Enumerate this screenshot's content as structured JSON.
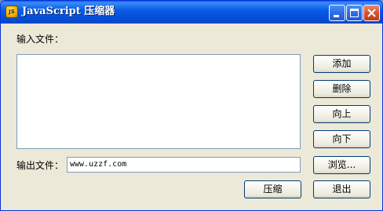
{
  "window": {
    "title": "JavaScript 压缩器",
    "app_icon_text": "JS"
  },
  "form": {
    "input_files_label": "输入文件：",
    "output_file_label": "输出文件：",
    "output_file_value": "www.uzzf.com"
  },
  "buttons": {
    "add": "添加",
    "delete": "删除",
    "move_up": "向上",
    "move_down": "向下",
    "browse": "浏览...",
    "compress": "压缩",
    "exit": "退出"
  },
  "theme": {
    "titlebar_blue": "#0a5de8",
    "window_bg": "#ece9d8",
    "close_red": "#d8522e"
  }
}
